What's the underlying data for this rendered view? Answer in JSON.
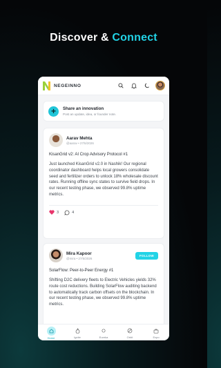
{
  "headline": {
    "part1": "Discover & ",
    "part2": "Connect"
  },
  "app": {
    "brand": "NEGEINNO"
  },
  "share": {
    "title": "Share an innovation",
    "subtitle": "Post an update, idea, or founder note."
  },
  "posts": [
    {
      "author": "Aarav Mehta",
      "meta": "@aarav • 27/5/2026",
      "title": "KisanGrid v2: AI Crop Advisory Protocol #1",
      "body": "Just launched KisanGrid v2.0 in Nashik! Our regional coordinator dashboard helps local growers consolidate seed and fertilizer orders to unlock 18% wholesale discount rates. Running offline sync states to survive field drops. In our recent testing phase, we observed 99.8% uptime metrics.",
      "likes": "3",
      "comments": "4"
    },
    {
      "author": "Mira Kapoor",
      "meta": "@mira • 27/5/2026",
      "follow_label": "FOLLOW",
      "title": "SolarFlow: Peer-to-Peer Energy #1",
      "body": "Shifting D2C delivery fleets to Electric Vehicles yields 32% route cost reductions. Building SolarFlow auditing backend to automatically track carbon offsets on the blockchain. In our recent testing phase, we observed 99.8% uptime metrics."
    }
  ],
  "nav": [
    {
      "label": "Home",
      "icon": "home-icon",
      "active": true
    },
    {
      "label": "Ignite",
      "icon": "flame-icon"
    },
    {
      "label": "Eureka",
      "icon": "bulb-icon"
    },
    {
      "label": "Orbit",
      "icon": "orbit-icon"
    },
    {
      "label": "Expo",
      "icon": "briefcase-icon"
    }
  ],
  "colors": {
    "accent": "#22d3e6",
    "like": "#e8356b",
    "background": "#050608"
  }
}
